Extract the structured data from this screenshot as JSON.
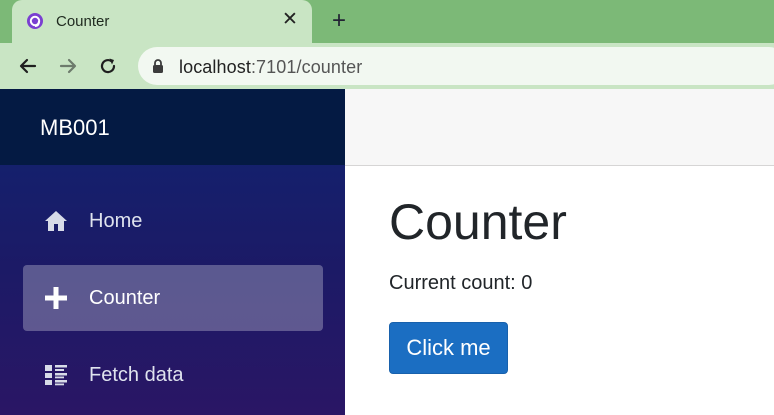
{
  "browser": {
    "tab_title": "Counter",
    "tab_close": "✕",
    "new_tab": "+",
    "url_host": "localhost",
    "url_rest": ":7101/counter"
  },
  "sidebar": {
    "brand": "MB001",
    "items": [
      {
        "label": "Home",
        "icon": "home-icon",
        "active": false
      },
      {
        "label": "Counter",
        "icon": "plus-icon",
        "active": true
      },
      {
        "label": "Fetch data",
        "icon": "list-icon",
        "active": false
      }
    ]
  },
  "main": {
    "title": "Counter",
    "count_text": "Current count: 0",
    "button_label": "Click me"
  },
  "colors": {
    "tabstrip": "#7cb977",
    "tab_active": "#c9e5c4",
    "brand_bar": "#041a43",
    "sidebar_top": "#0f2471",
    "sidebar_bottom": "#2a1665",
    "button_primary": "#1b6ec2"
  }
}
